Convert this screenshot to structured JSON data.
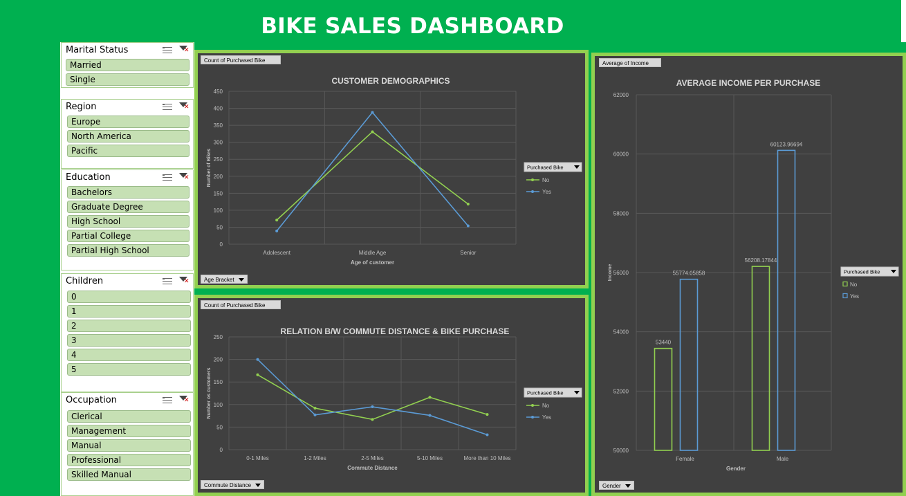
{
  "dashboard_title": "BIKE SALES DASHBOARD",
  "colors": {
    "green": "#00b050",
    "panel_border": "#92d050",
    "panel_bg": "#404040",
    "series_no": "#92d050",
    "series_yes": "#5b9bd5",
    "slicer_item": "#c6e0b4"
  },
  "slicers": [
    {
      "title": "Marital Status",
      "items": [
        "Married",
        "Single"
      ]
    },
    {
      "title": "Region",
      "items": [
        "Europe",
        "North America",
        "Pacific"
      ]
    },
    {
      "title": "Education",
      "items": [
        "Bachelors",
        "Graduate Degree",
        "High School",
        "Partial College",
        "Partial High School"
      ]
    },
    {
      "title": "Children",
      "items": [
        "0",
        "1",
        "2",
        "3",
        "4",
        "5"
      ]
    },
    {
      "title": "Occupation",
      "items": [
        "Clerical",
        "Management",
        "Manual",
        "Professional",
        "Skilled Manual"
      ]
    }
  ],
  "icons": {
    "multi_select": "multi-select-icon",
    "clear_filter": "clear-filter-icon"
  },
  "chart_data": [
    {
      "type": "line",
      "title": "CUSTOMER DEMOGRAPHICS",
      "value_field": "Count of Purchased Bike",
      "axis_field": "Age Bracket",
      "legend_field": "Purchased Bike",
      "xlabel": "Age of customer",
      "ylabel": "Number of Bikes",
      "categories": [
        "Adolescent",
        "Middle Age",
        "Senior"
      ],
      "series": [
        {
          "name": "No",
          "values": [
            71,
            331,
            118
          ]
        },
        {
          "name": "Yes",
          "values": [
            39,
            388,
            54
          ]
        }
      ],
      "ylim": [
        0,
        450
      ],
      "yticks": [
        0,
        50,
        100,
        150,
        200,
        250,
        300,
        350,
        400,
        450
      ],
      "grid": true,
      "legend": "right"
    },
    {
      "type": "line",
      "title": "RELATION B/W COMMUTE DISTANCE & BIKE PURCHASE",
      "value_field": "Count of Purchased Bike",
      "axis_field": "Commute Distance",
      "legend_field": "Purchased Bike",
      "xlabel": "Commute Distance",
      "ylabel": "Number os customers",
      "categories": [
        "0-1 Miles",
        "1-2 Miles",
        "2-5 Miles",
        "5-10 Miles",
        "More than 10 Miles"
      ],
      "series": [
        {
          "name": "No",
          "values": [
            166,
            92,
            67,
            116,
            78
          ]
        },
        {
          "name": "Yes",
          "values": [
            200,
            77,
            95,
            76,
            33
          ]
        }
      ],
      "ylim": [
        0,
        250
      ],
      "yticks": [
        0,
        50,
        100,
        150,
        200,
        250
      ],
      "grid": true,
      "legend": "right"
    },
    {
      "type": "bar",
      "title": "AVERAGE INCOME PER PURCHASE",
      "value_field": "Average of Income",
      "axis_field": "Gender",
      "legend_field": "Purchased Bike",
      "xlabel": "Gender",
      "ylabel": "Income",
      "categories": [
        "Female",
        "Male"
      ],
      "series": [
        {
          "name": "No",
          "values": [
            53440,
            56208.17844
          ],
          "labels": [
            "53440",
            "56208.17844"
          ]
        },
        {
          "name": "Yes",
          "values": [
            55774.05858,
            60123.96694
          ],
          "labels": [
            "55774.05858",
            "60123.96694"
          ]
        }
      ],
      "ylim": [
        50000,
        62000
      ],
      "yticks": [
        50000,
        52000,
        54000,
        56000,
        58000,
        60000,
        62000
      ],
      "grid": true,
      "legend": "right"
    }
  ]
}
